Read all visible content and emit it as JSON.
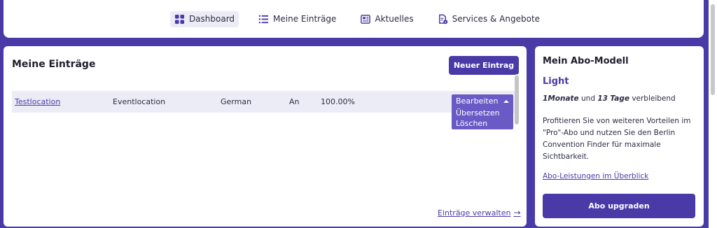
{
  "nav": {
    "items": [
      {
        "label": "Dashboard",
        "icon": "dashboard-grid-icon",
        "active": true
      },
      {
        "label": "Meine Einträge",
        "icon": "list-icon",
        "active": false
      },
      {
        "label": "Aktuelles",
        "icon": "newspaper-icon",
        "active": false
      },
      {
        "label": "Services & Angebote",
        "icon": "document-info-icon",
        "active": false
      }
    ]
  },
  "entries": {
    "title": "Meine Einträge",
    "new_button": "Neuer Eintrag",
    "rows": [
      {
        "name": "Testlocation",
        "type": "Eventlocation",
        "language": "German",
        "status": "An",
        "percent": "100.00%"
      }
    ],
    "actions": {
      "selected": "Bearbeiten",
      "options": [
        "Übersetzen",
        "Löschen"
      ]
    },
    "manage_link": "Einträge verwalten"
  },
  "abo": {
    "title": "Mein Abo-Modell",
    "plan": "Light",
    "months": "1",
    "months_label": "Monate",
    "and": "und",
    "days": "13",
    "days_label": "Tage",
    "remaining": "verbleibend",
    "promo": "Profitieren Sie von weiteren Vorteilen im \"Pro\"-Abo und nutzen Sie den Berlin Convention Finder für maximale Sichtbarkeit.",
    "benefits_link": "Abo-Leistungen im Überblick",
    "upgrade_button": "Abo upgraden"
  },
  "colors": {
    "brand": "#4a3aa7",
    "dropdown": "#6a5ac6",
    "row_bg": "#ececf6"
  }
}
